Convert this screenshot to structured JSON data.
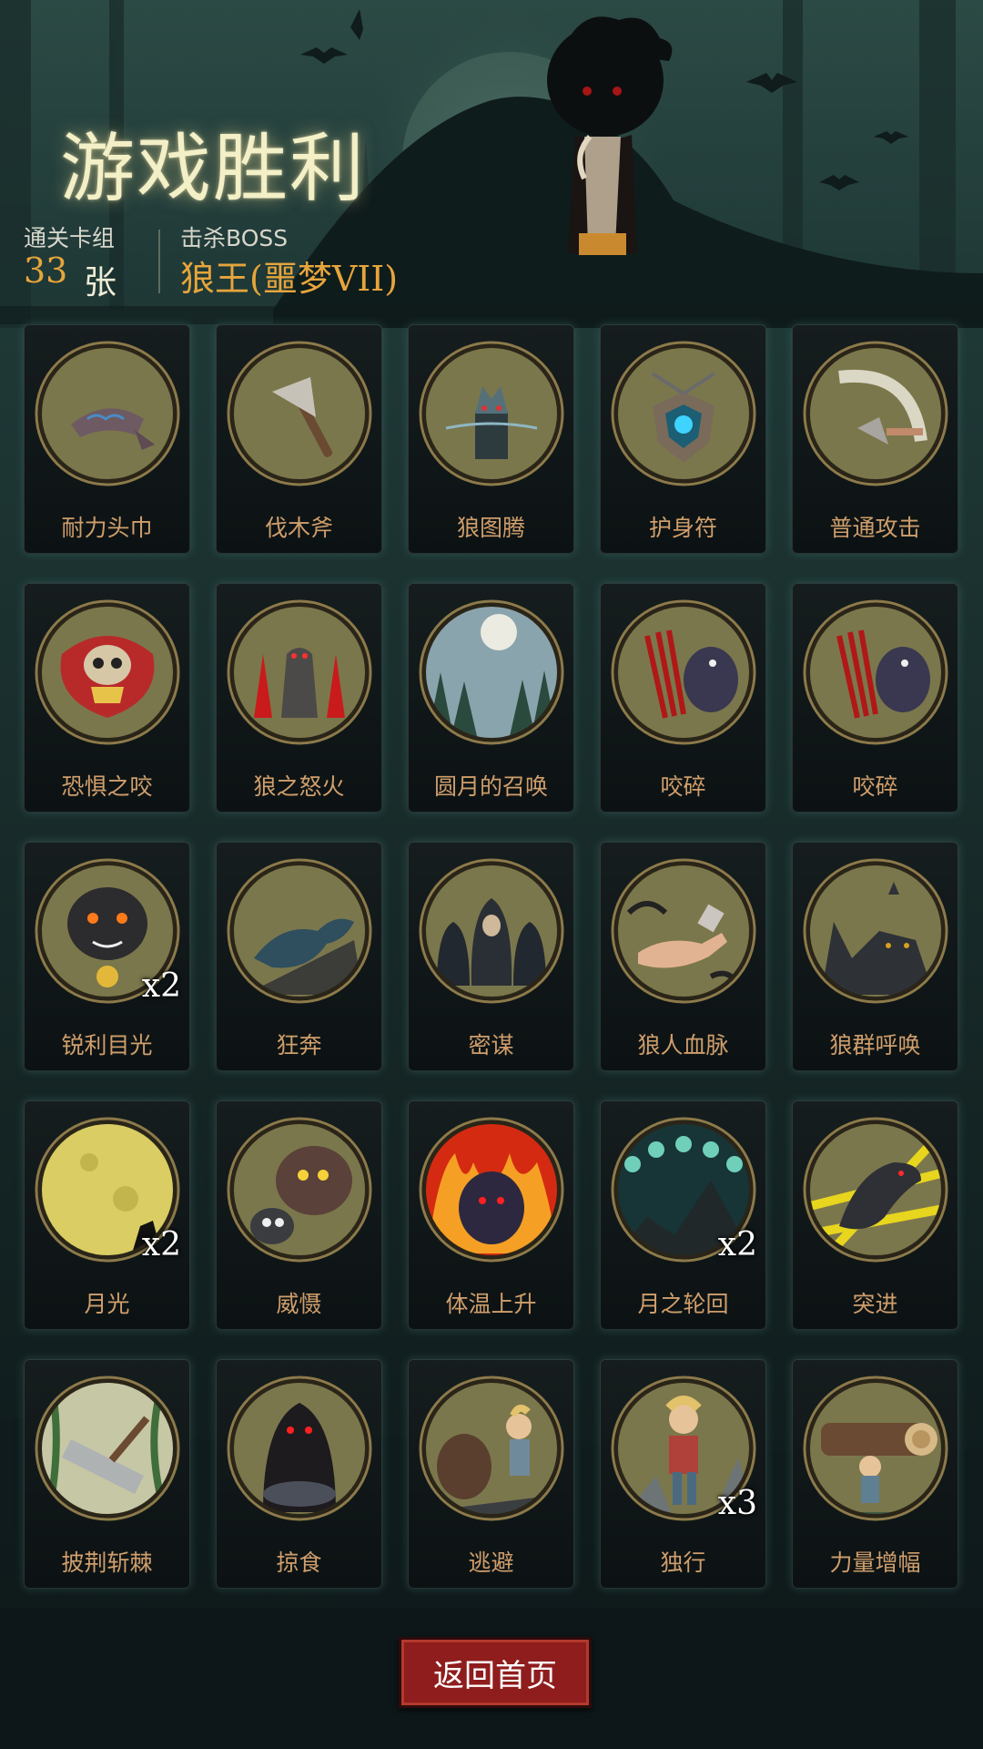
{
  "header": {
    "title": "游戏胜利",
    "cleared_deck_label": "通关卡组",
    "cleared_deck_count": "33",
    "cleared_deck_unit": "张",
    "boss_label": "击杀BOSS",
    "boss_name": "狼王(噩梦VII)"
  },
  "colors": {
    "accent_orange": "#e6a53c",
    "card_name": "#cf9e6c",
    "button_red": "#8f1d1d"
  },
  "cards": [
    {
      "name": "耐力头巾",
      "count": "",
      "icon": "bandana-icon"
    },
    {
      "name": "伐木斧",
      "count": "",
      "icon": "axe-icon"
    },
    {
      "name": "狼图腾",
      "count": "",
      "icon": "wolf-totem-icon"
    },
    {
      "name": "护身符",
      "count": "",
      "icon": "amulet-icon"
    },
    {
      "name": "普通攻击",
      "count": "",
      "icon": "axe-slash-icon"
    },
    {
      "name": "恐惧之咬",
      "count": "",
      "icon": "fear-bite-icon"
    },
    {
      "name": "狼之怒火",
      "count": "",
      "icon": "wolf-rage-icon"
    },
    {
      "name": "圆月的召唤",
      "count": "",
      "icon": "full-moon-forest-icon"
    },
    {
      "name": "咬碎",
      "count": "",
      "icon": "claw-strike-icon"
    },
    {
      "name": "咬碎",
      "count": "",
      "icon": "claw-strike-icon"
    },
    {
      "name": "锐利目光",
      "count": "x2",
      "icon": "sharp-gaze-icon"
    },
    {
      "name": "狂奔",
      "count": "",
      "icon": "running-wolf-icon"
    },
    {
      "name": "密谋",
      "count": "",
      "icon": "hooded-figures-icon"
    },
    {
      "name": "狼人血脉",
      "count": "",
      "icon": "werewolf-hand-icon"
    },
    {
      "name": "狼群呼唤",
      "count": "",
      "icon": "howling-pack-icon"
    },
    {
      "name": "月光",
      "count": "x2",
      "icon": "moonlight-icon"
    },
    {
      "name": "威慑",
      "count": "",
      "icon": "bear-deter-icon"
    },
    {
      "name": "体温上升",
      "count": "",
      "icon": "flaming-wolf-icon"
    },
    {
      "name": "月之轮回",
      "count": "x2",
      "icon": "moon-phases-icon"
    },
    {
      "name": "突进",
      "count": "",
      "icon": "wolf-lunge-icon"
    },
    {
      "name": "披荆斩棘",
      "count": "",
      "icon": "thorn-cleave-icon"
    },
    {
      "name": "掠食",
      "count": "",
      "icon": "predator-icon"
    },
    {
      "name": "逃避",
      "count": "",
      "icon": "escape-icon"
    },
    {
      "name": "独行",
      "count": "x3",
      "icon": "lone-hiker-icon"
    },
    {
      "name": "力量增幅",
      "count": "",
      "icon": "log-carry-icon"
    }
  ],
  "footer": {
    "home_button_label": "返回首页"
  }
}
